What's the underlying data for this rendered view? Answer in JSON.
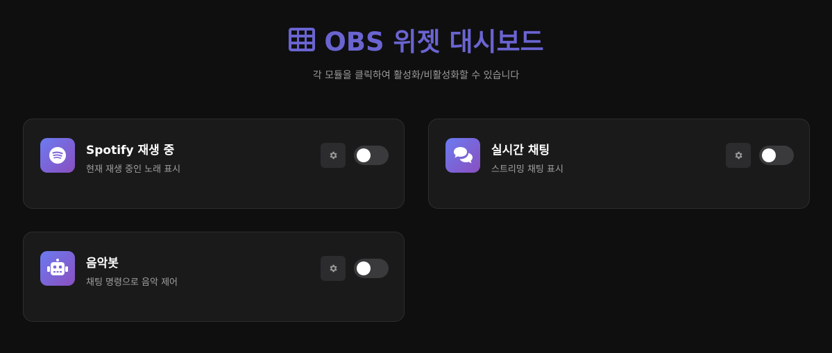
{
  "header": {
    "title": "OBS 위젯 대시보드",
    "subtitle": "각 모듈을 클릭하여 활성화/비활성화할 수 있습니다",
    "icon": "grid-table-icon"
  },
  "colors": {
    "background": "#0f0f10",
    "accent": "#6a64d1",
    "card": "#1a1a1b",
    "icon_gradient_start": "#6b7bf0",
    "icon_gradient_end": "#8a4fc0"
  },
  "modules": [
    {
      "title": "Spotify 재생 중",
      "description": "현재 재생 중인 노래 표시",
      "icon": "spotify-icon",
      "enabled": false
    },
    {
      "title": "실시간 채팅",
      "description": "스트리밍 채팅 표시",
      "icon": "chat-bubbles-icon",
      "enabled": false
    },
    {
      "title": "음악봇",
      "description": "채팅 명령으로 음악 제어",
      "icon": "robot-icon",
      "enabled": false
    }
  ]
}
